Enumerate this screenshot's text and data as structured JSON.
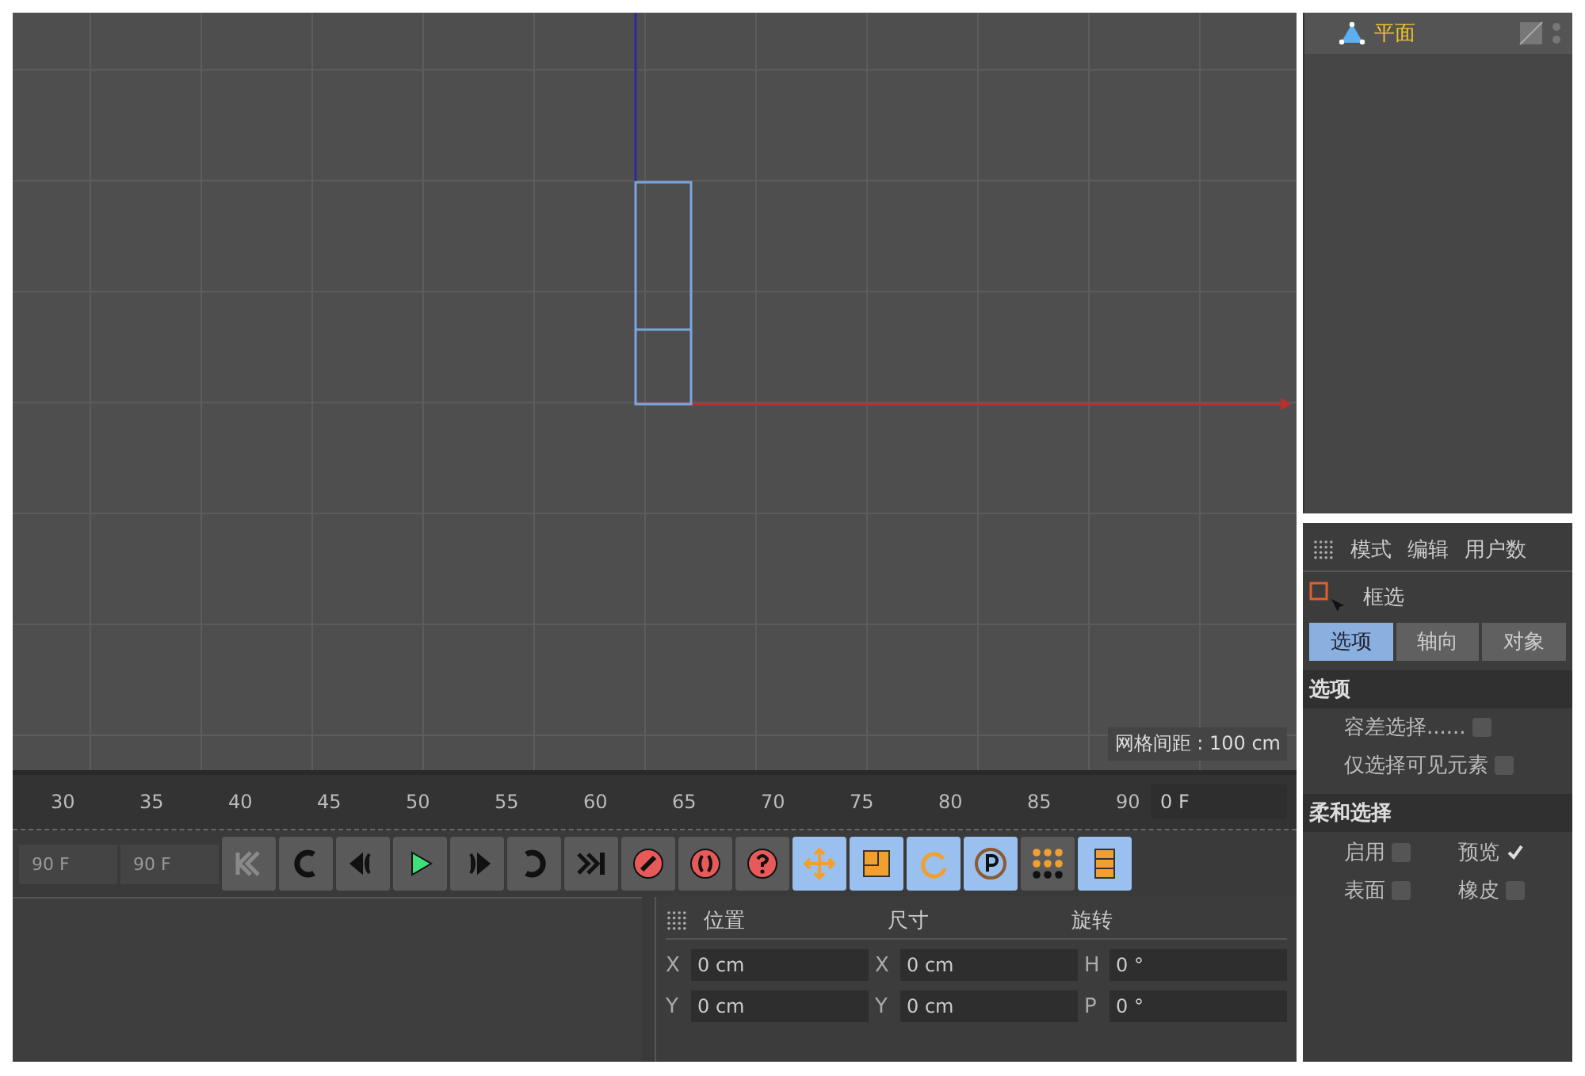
{
  "viewport": {
    "grid_label": "网格间距 : 100 cm"
  },
  "timeline": {
    "ticks": [
      "30",
      "35",
      "40",
      "45",
      "50",
      "55",
      "60",
      "65",
      "70",
      "75",
      "80",
      "85",
      "90"
    ],
    "current_frame": "0 F"
  },
  "transport": {
    "fields": [
      "90 F",
      "90 F"
    ],
    "buttons": [
      {
        "kind": "first",
        "selected": false
      },
      {
        "kind": "prev-key",
        "selected": false
      },
      {
        "kind": "prev-frame",
        "selected": false
      },
      {
        "kind": "play",
        "selected": false
      },
      {
        "kind": "next-frame",
        "selected": false
      },
      {
        "kind": "next-key",
        "selected": false
      },
      {
        "kind": "last",
        "selected": false
      },
      {
        "kind": "record",
        "selected": false
      },
      {
        "kind": "autokey",
        "selected": false
      },
      {
        "kind": "help",
        "selected": false
      },
      {
        "kind": "move",
        "selected": true
      },
      {
        "kind": "scale",
        "selected": true
      },
      {
        "kind": "rotate",
        "selected": true
      },
      {
        "kind": "param",
        "selected": true
      },
      {
        "kind": "points",
        "selected": false
      },
      {
        "kind": "film",
        "selected": true
      }
    ]
  },
  "coordinates": {
    "headers": [
      "位置",
      "尺寸",
      "旋转"
    ],
    "rows": [
      {
        "cells": [
          {
            "axis": "X",
            "value": "0 cm"
          },
          {
            "axis": "X",
            "value": "0 cm"
          },
          {
            "axis": "H",
            "value": "0 °"
          }
        ]
      },
      {
        "cells": [
          {
            "axis": "Y",
            "value": "0 cm"
          },
          {
            "axis": "Y",
            "value": "0 cm"
          },
          {
            "axis": "P",
            "value": "0 °"
          }
        ]
      }
    ]
  },
  "object_manager": {
    "objects": [
      {
        "name": "平面",
        "selected": true
      }
    ]
  },
  "attributes": {
    "menu": [
      "模式",
      "编辑",
      "用户数"
    ],
    "tool": "框选",
    "tabs": [
      {
        "label": "选项",
        "selected": true
      },
      {
        "label": "轴向",
        "selected": false
      },
      {
        "label": "对象",
        "selected": false
      }
    ],
    "sections": [
      {
        "title": "选项",
        "rows": [
          {
            "label": "容差选择......",
            "checked": false
          },
          {
            "label": "仅选择可见元素",
            "checked": false
          }
        ]
      },
      {
        "title": "柔和选择",
        "pairs": [
          {
            "label": "启用",
            "checked": false
          },
          {
            "label": "预览",
            "checked": true
          },
          {
            "label": "表面",
            "checked": false
          },
          {
            "label": "橡皮",
            "checked": false
          }
        ]
      }
    ]
  }
}
